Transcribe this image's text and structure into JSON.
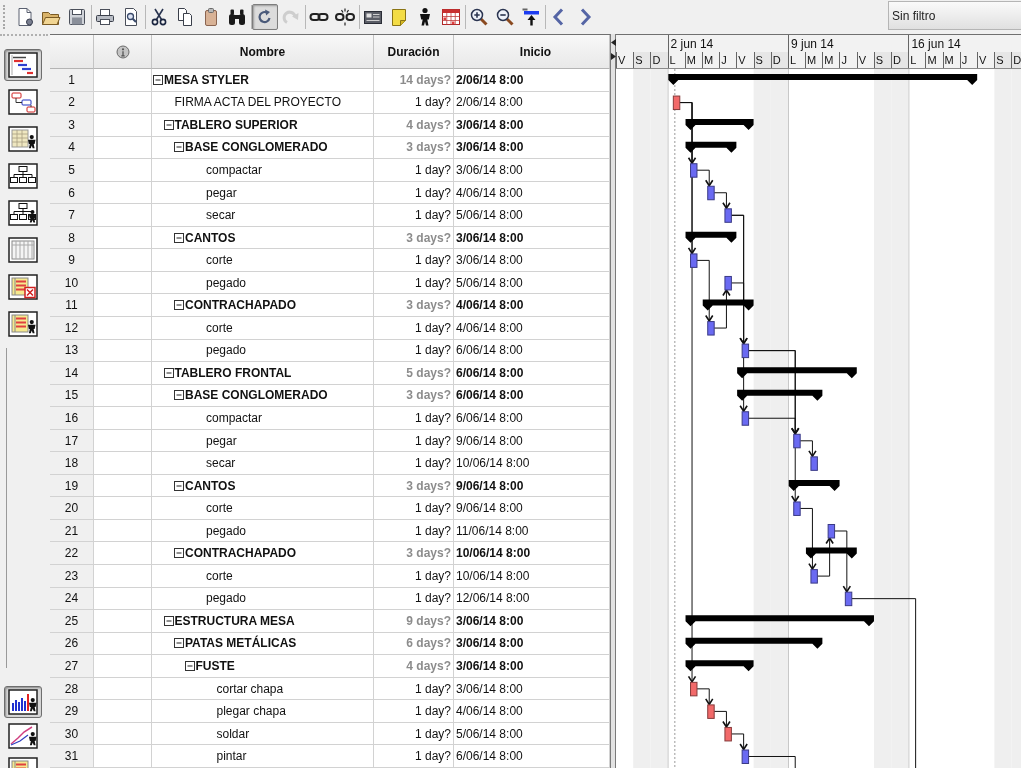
{
  "toolbar": [
    {
      "buttons": [
        {
          "kind": "new",
          "selected": false,
          "disabled": false
        },
        {
          "kind": "open",
          "selected": false,
          "disabled": false
        },
        {
          "kind": "save",
          "selected": false,
          "disabled": false
        }
      ]
    },
    {
      "buttons": [
        {
          "kind": "print",
          "selected": false,
          "disabled": false
        },
        {
          "kind": "preview",
          "selected": false,
          "disabled": false
        }
      ]
    },
    {
      "buttons": [
        {
          "kind": "cut",
          "selected": false,
          "disabled": false
        },
        {
          "kind": "copy",
          "selected": false,
          "disabled": false
        },
        {
          "kind": "paste",
          "selected": false,
          "disabled": false
        },
        {
          "kind": "find",
          "selected": false,
          "disabled": false
        }
      ]
    },
    {
      "buttons": [
        {
          "kind": "undo",
          "selected": true,
          "disabled": false
        },
        {
          "kind": "redo",
          "selected": false,
          "disabled": true
        }
      ]
    },
    {
      "buttons": [
        {
          "kind": "link",
          "selected": false,
          "disabled": false
        },
        {
          "kind": "unlink",
          "selected": false,
          "disabled": false
        }
      ]
    },
    {
      "buttons": [
        {
          "kind": "info",
          "selected": false,
          "disabled": false
        },
        {
          "kind": "notes",
          "selected": false,
          "disabled": false
        },
        {
          "kind": "resource",
          "selected": false,
          "disabled": false
        },
        {
          "kind": "calendar",
          "selected": false,
          "disabled": false
        }
      ]
    },
    {
      "buttons": [
        {
          "kind": "zoomin",
          "selected": false,
          "disabled": false
        },
        {
          "kind": "zoomout",
          "selected": false,
          "disabled": false
        },
        {
          "kind": "scroll",
          "selected": false,
          "disabled": false
        }
      ]
    },
    {
      "buttons": [
        {
          "kind": "previous",
          "selected": false,
          "disabled": false
        },
        {
          "kind": "next",
          "selected": false,
          "disabled": false
        }
      ]
    }
  ],
  "filter": {
    "value": "Sin filtro"
  },
  "sidebar": {
    "views": [
      {
        "kind": "gantt",
        "selected": true
      },
      {
        "kind": "network",
        "selected": false
      },
      {
        "kind": "resources",
        "selected": false
      },
      {
        "kind": "wbs",
        "selected": false
      },
      {
        "kind": "rbs",
        "selected": false
      },
      {
        "kind": "projects",
        "selected": false
      },
      {
        "kind": "taskusage",
        "selected": false
      },
      {
        "kind": "resourceusage",
        "selected": false
      }
    ],
    "panels": [
      {
        "kind": "histogram",
        "selected": true
      },
      {
        "kind": "charts",
        "selected": false
      },
      {
        "kind": "usage",
        "selected": false
      }
    ]
  },
  "table": {
    "columns": [
      "Nombre",
      "Duración",
      "Inicio"
    ],
    "tasks": [
      {
        "number": "1",
        "name": "MESA STYLER",
        "duration": "14 days?",
        "start": "2/06/14 8:00",
        "expanded": true,
        "children": [
          {
            "number": "2",
            "name": "FIRMA ACTA DEL PROYECTO",
            "duration": "1 day?",
            "start": "2/06/14 8:00",
            "color": "#f26a6a"
          },
          {
            "number": "3",
            "name": "TABLERO SUPERIOR",
            "duration": "4 days?",
            "start": "3/06/14 8:00",
            "expanded": true,
            "children": [
              {
                "number": "4",
                "name": "BASE CONGLOMERADO",
                "duration": "3 days?",
                "start": "3/06/14 8:00",
                "expanded": true,
                "children": [
                  {
                    "number": "5",
                    "name": "compactar",
                    "duration": "1 day?",
                    "start": "3/06/14 8:00",
                    "color": "#6a6af2"
                  },
                  {
                    "number": "6",
                    "name": "pegar",
                    "duration": "1 day?",
                    "start": "4/06/14 8:00",
                    "color": "#6a6af2"
                  },
                  {
                    "number": "7",
                    "name": "secar",
                    "duration": "1 day?",
                    "start": "5/06/14 8:00",
                    "color": "#6a6af2"
                  }
                ]
              },
              {
                "number": "8",
                "name": "CANTOS",
                "duration": "3 days?",
                "start": "3/06/14 8:00",
                "expanded": true,
                "children": [
                  {
                    "number": "9",
                    "name": "corte",
                    "duration": "1 day?",
                    "start": "3/06/14 8:00",
                    "color": "#6a6af2"
                  },
                  {
                    "number": "10",
                    "name": "pegado",
                    "duration": "1 day?",
                    "start": "5/06/14 8:00",
                    "color": "#6a6af2"
                  }
                ]
              },
              {
                "number": "11",
                "name": "CONTRACHAPADO",
                "duration": "3 days?",
                "start": "4/06/14 8:00",
                "expanded": true,
                "children": [
                  {
                    "number": "12",
                    "name": "corte",
                    "duration": "1 day?",
                    "start": "4/06/14 8:00",
                    "color": "#6a6af2"
                  },
                  {
                    "number": "13",
                    "name": "pegado",
                    "duration": "1 day?",
                    "start": "6/06/14 8:00",
                    "color": "#6a6af2"
                  }
                ]
              }
            ]
          },
          {
            "number": "14",
            "name": "TABLERO FRONTAL",
            "duration": "5 days?",
            "start": "6/06/14 8:00",
            "expanded": true,
            "children": [
              {
                "number": "15",
                "name": "BASE CONGLOMERADO",
                "duration": "3 days?",
                "start": "6/06/14 8:00",
                "expanded": true,
                "children": [
                  {
                    "number": "16",
                    "name": "compactar",
                    "duration": "1 day?",
                    "start": "6/06/14 8:00",
                    "color": "#6a6af2"
                  },
                  {
                    "number": "17",
                    "name": "pegar",
                    "duration": "1 day?",
                    "start": "9/06/14 8:00",
                    "color": "#6a6af2"
                  },
                  {
                    "number": "18",
                    "name": "secar",
                    "duration": "1 day?",
                    "start": "10/06/14 8:00",
                    "color": "#6a6af2"
                  }
                ]
              },
              {
                "number": "19",
                "name": "CANTOS",
                "duration": "3 days?",
                "start": "9/06/14 8:00",
                "expanded": true,
                "children": [
                  {
                    "number": "20",
                    "name": "corte",
                    "duration": "1 day?",
                    "start": "9/06/14 8:00",
                    "color": "#6a6af2"
                  },
                  {
                    "number": "21",
                    "name": "pegado",
                    "duration": "1 day?",
                    "start": "11/06/14 8:00",
                    "color": "#6a6af2"
                  }
                ]
              },
              {
                "number": "22",
                "name": "CONTRACHAPADO",
                "duration": "3 days?",
                "start": "10/06/14 8:00",
                "expanded": true,
                "children": [
                  {
                    "number": "23",
                    "name": "corte",
                    "duration": "1 day?",
                    "start": "10/06/14 8:00",
                    "color": "#6a6af2"
                  },
                  {
                    "number": "24",
                    "name": "pegado",
                    "duration": "1 day?",
                    "start": "12/06/14 8:00",
                    "color": "#6a6af2"
                  }
                ]
              }
            ]
          },
          {
            "number": "25",
            "name": "ESTRUCTURA MESA",
            "duration": "9 days?",
            "start": "3/06/14 8:00",
            "expanded": true,
            "children": [
              {
                "number": "26",
                "name": "PATAS METÁLICAS",
                "duration": "6 days?",
                "start": "3/06/14 8:00",
                "expanded": true,
                "children": [
                  {
                    "number": "27",
                    "name": "FUSTE",
                    "duration": "4 days?",
                    "start": "3/06/14 8:00",
                    "expanded": true,
                    "children": [
                      {
                        "number": "28",
                        "name": "cortar chapa",
                        "duration": "1 day?",
                        "start": "3/06/14 8:00",
                        "color": "#f26a6a"
                      },
                      {
                        "number": "29",
                        "name": "plegar chapa",
                        "duration": "1 day?",
                        "start": "4/06/14 8:00",
                        "color": "#f26a6a"
                      },
                      {
                        "number": "30",
                        "name": "soldar",
                        "duration": "1 day?",
                        "start": "5/06/14 8:00",
                        "color": "#f26a6a"
                      },
                      {
                        "number": "31",
                        "name": "pintar",
                        "duration": "1 day?",
                        "start": "6/06/14 8:00",
                        "color": "#6a6af2"
                      }
                    ]
                  }
                ]
              }
            ]
          }
        ]
      }
    ]
  },
  "timescale": {
    "weeks": [
      "2 jun 14",
      "9 jun 14",
      "16 jun 14"
    ],
    "days": [
      {
        "label": "V",
        "weekend": false
      },
      {
        "label": "S",
        "weekend": true
      },
      {
        "label": "D",
        "weekend": true
      },
      {
        "label": "L",
        "weekend": false
      },
      {
        "label": "M",
        "weekend": false
      },
      {
        "label": "M",
        "weekend": false
      },
      {
        "label": "J",
        "weekend": false
      },
      {
        "label": "V",
        "weekend": false
      },
      {
        "label": "S",
        "weekend": true
      },
      {
        "label": "D",
        "weekend": true
      },
      {
        "label": "L",
        "weekend": false
      },
      {
        "label": "M",
        "weekend": false
      },
      {
        "label": "M",
        "weekend": false
      },
      {
        "label": "J",
        "weekend": false
      },
      {
        "label": "V",
        "weekend": false
      },
      {
        "label": "S",
        "weekend": true
      },
      {
        "label": "D",
        "weekend": true
      },
      {
        "label": "L",
        "weekend": false
      },
      {
        "label": "M",
        "weekend": false
      },
      {
        "label": "M",
        "weekend": false
      },
      {
        "label": "J",
        "weekend": false
      },
      {
        "label": "V",
        "weekend": false
      },
      {
        "label": "S",
        "weekend": true
      },
      {
        "label": "D",
        "weekend": true
      }
    ]
  }
}
